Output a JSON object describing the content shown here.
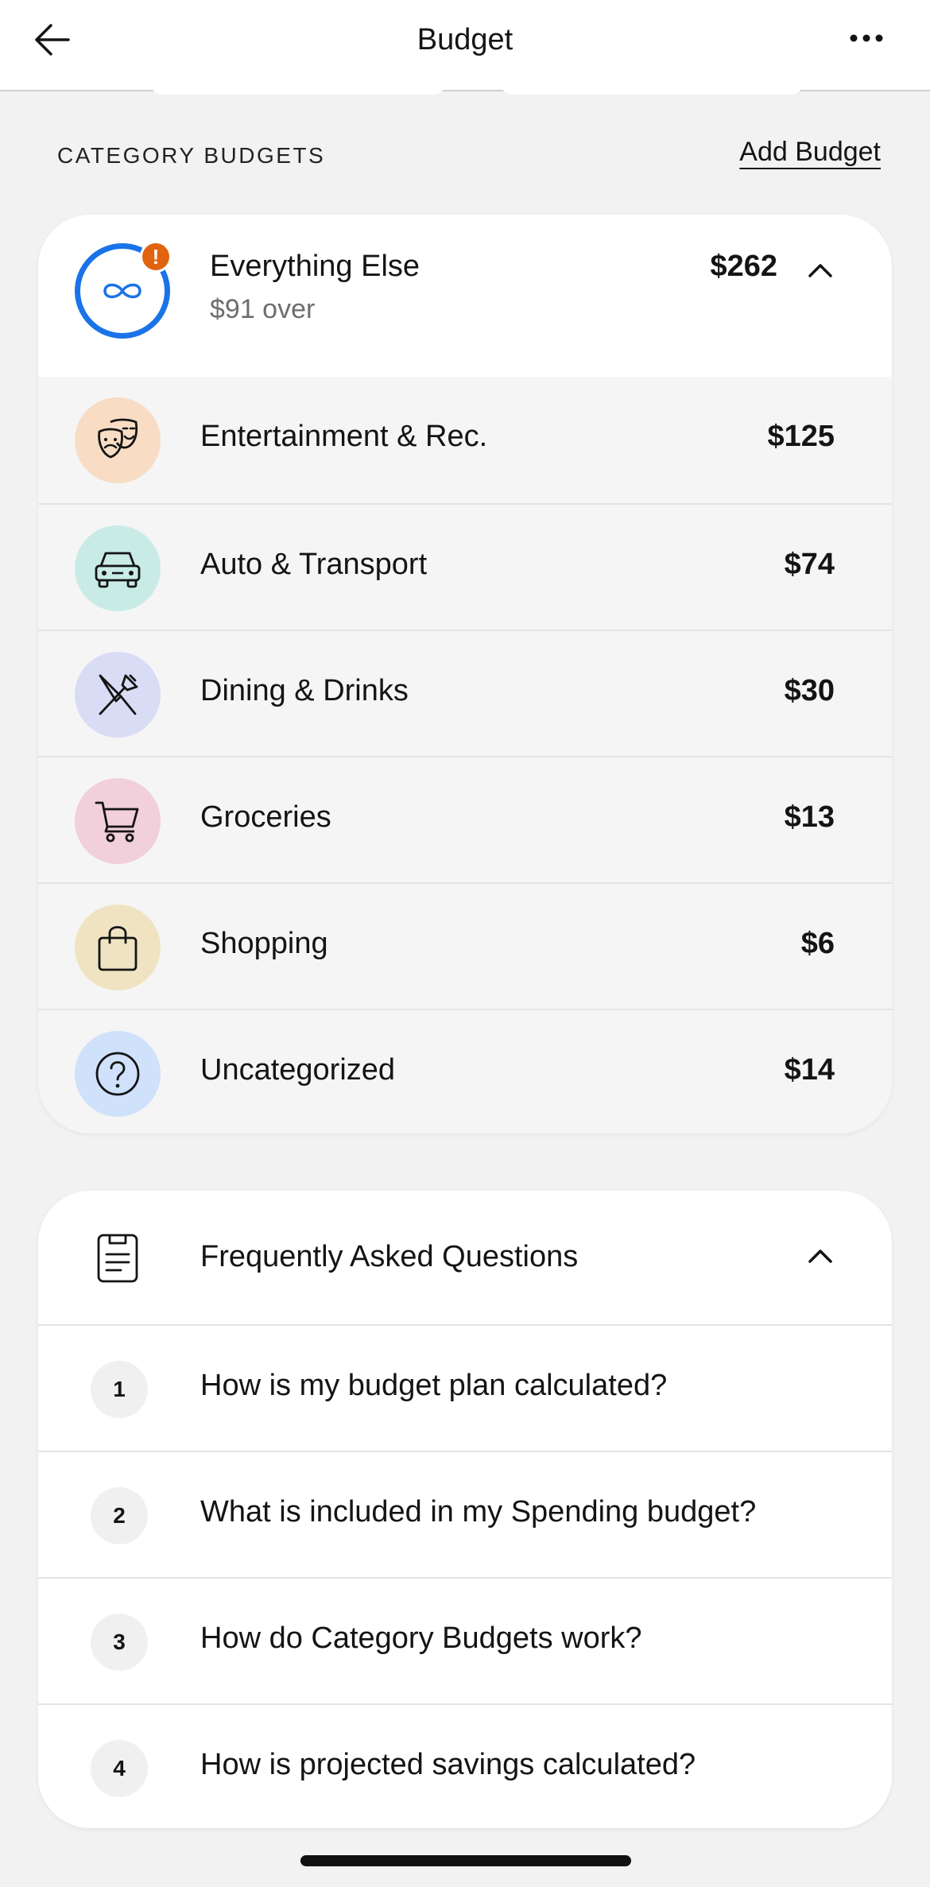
{
  "header": {
    "title": "Budget",
    "back_icon": "arrow-left-icon",
    "more_icon": "ellipsis-icon"
  },
  "section": {
    "title": "CATEGORY BUDGETS",
    "add_label": "Add Budget"
  },
  "budget": {
    "name": "Everything Else",
    "status": "$91 over",
    "amount": "$262",
    "alert": "!",
    "accent_color": "#1a73e8",
    "alert_color": "#e06410",
    "categories": [
      {
        "label": "Entertainment & Rec.",
        "amount": "$125",
        "icon": "theater-masks-icon",
        "color": "#f8dcc4"
      },
      {
        "label": "Auto & Transport",
        "amount": "$74",
        "icon": "car-icon",
        "color": "#c8ebe6"
      },
      {
        "label": "Dining & Drinks",
        "amount": "$30",
        "icon": "fork-knife-icon",
        "color": "#d9dcf5"
      },
      {
        "label": "Groceries",
        "amount": "$13",
        "icon": "shopping-cart-icon",
        "color": "#f1cfdb"
      },
      {
        "label": "Shopping",
        "amount": "$6",
        "icon": "shopping-bag-icon",
        "color": "#efe3c2"
      },
      {
        "label": "Uncategorized",
        "amount": "$14",
        "icon": "question-circle-icon",
        "color": "#cfe1fb"
      }
    ]
  },
  "faq": {
    "title": "Frequently Asked Questions",
    "items": [
      {
        "num": "1",
        "question": "How is my budget plan calculated?"
      },
      {
        "num": "2",
        "question": "What is included in my Spending budget?"
      },
      {
        "num": "3",
        "question": "How do Category Budgets work?"
      },
      {
        "num": "4",
        "question": "How is projected savings calculated?"
      }
    ]
  }
}
